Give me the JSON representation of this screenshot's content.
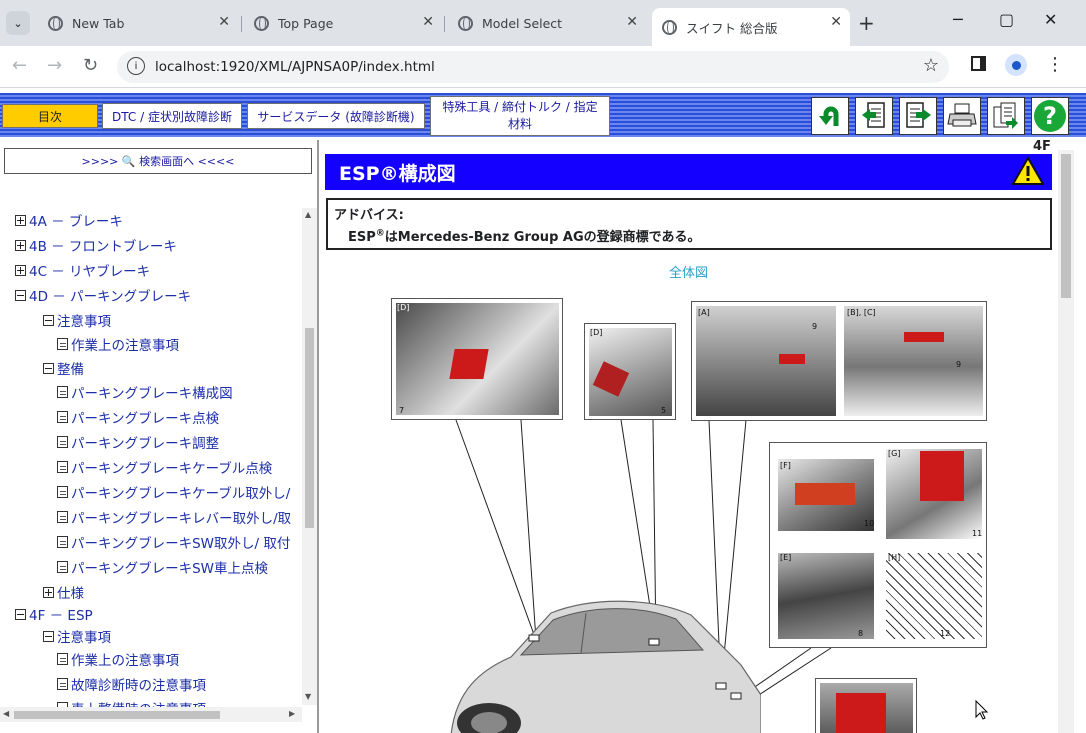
{
  "browser": {
    "tabs": [
      {
        "title": "New Tab"
      },
      {
        "title": "Top Page"
      },
      {
        "title": "Model Select"
      },
      {
        "title": "スイフト 総合版"
      }
    ],
    "url": "localhost:1920/XML/AJPNSA0P/index.html"
  },
  "toolbar": {
    "buttons": [
      "目次",
      "DTC / 症状別故障診断",
      "サービスデータ (故障診断機)",
      "特殊工具 / 締付トルク / 指定材料"
    ],
    "icons": [
      "back-icon",
      "prev-page-icon",
      "next-page-icon",
      "print-icon",
      "copy-icon",
      "help-icon"
    ]
  },
  "sidebar": {
    "search_label": ">>>> 🔍 検索画面へ <<<<",
    "items": [
      "4A － ブレーキ",
      "4B － フロントブレーキ",
      "4C － リヤブレーキ",
      "4D － パーキングブレーキ",
      "注意事項",
      "作業上の注意事項",
      "整備",
      "パーキングブレーキ構成図",
      "パーキングブレーキ点検",
      "パーキングブレーキ調整",
      "パーキングブレーキケーブル点検",
      "パーキングブレーキケーブル取外し/",
      "パーキングブレーキレバー取外し/取",
      "パーキングブレーキSW取外し/ 取付",
      "パーキングブレーキSW車上点検",
      "仕様",
      "4F － ESP",
      "注意事項",
      "作業上の注意事項",
      "故障診断時の注意事項",
      "車上整備時の注意事項"
    ]
  },
  "content": {
    "section_code": "4F",
    "title": "ESP®構成図",
    "advice_heading": "アドバイス:",
    "advice_pre": "ESP",
    "advice_sup": "®",
    "advice_post": "はMercedes-Benz Group AGの登録商標である。",
    "figure_link": "全体図",
    "figure_labels": {
      "d1": "[D]",
      "d2": "[D]",
      "a": "[A]",
      "bc": "[B], [C]",
      "f": "[F]",
      "g": "[G]",
      "e": "[E]",
      "h": "[H]",
      "n7": "7",
      "n5": "5",
      "n9a": "9",
      "n9b": "9",
      "n10": "10",
      "n11": "11",
      "n8": "8",
      "n12": "12"
    }
  }
}
